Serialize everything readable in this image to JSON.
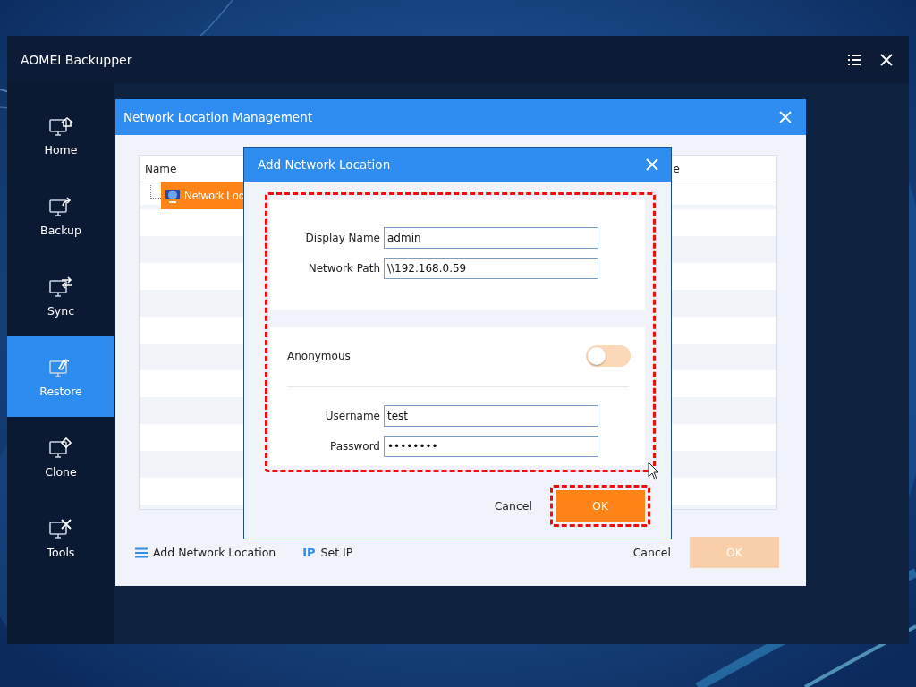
{
  "window": {
    "title": "AOMEI Backupper"
  },
  "sidebar": {
    "items": [
      {
        "kind": "home",
        "label": "Home",
        "selected": false
      },
      {
        "kind": "backup",
        "label": "Backup",
        "selected": false
      },
      {
        "kind": "sync",
        "label": "Sync",
        "selected": false
      },
      {
        "kind": "restore",
        "label": "Restore",
        "selected": true
      },
      {
        "kind": "clone",
        "label": "Clone",
        "selected": false
      },
      {
        "kind": "tools",
        "label": "Tools",
        "selected": false
      }
    ]
  },
  "manager": {
    "title": "Network Location Management",
    "table": {
      "columns": [
        "Name",
        "e"
      ],
      "rows": [
        {
          "name": "Network Loc",
          "selected": true
        }
      ]
    },
    "actions": [
      {
        "kind": "list",
        "label": "Add Network Location"
      },
      {
        "kind": "ip",
        "icon_text": "IP",
        "label": "Set IP"
      }
    ],
    "cancel": "Cancel",
    "ok": {
      "label": "OK",
      "disabled": true
    }
  },
  "dialog": {
    "title": "Add Network Location",
    "fields": [
      {
        "label": "Display Name",
        "value": "admin"
      },
      {
        "label": "Network Path",
        "value": "\\\\192.168.0.59"
      }
    ],
    "anonymous": {
      "label": "Anonymous",
      "on": false
    },
    "credentials": [
      {
        "kind": "text",
        "label": "Username",
        "value": "test"
      },
      {
        "kind": "password",
        "label": "Password",
        "value": "••••••••"
      }
    ],
    "cancel": "Cancel",
    "ok": "OK"
  }
}
